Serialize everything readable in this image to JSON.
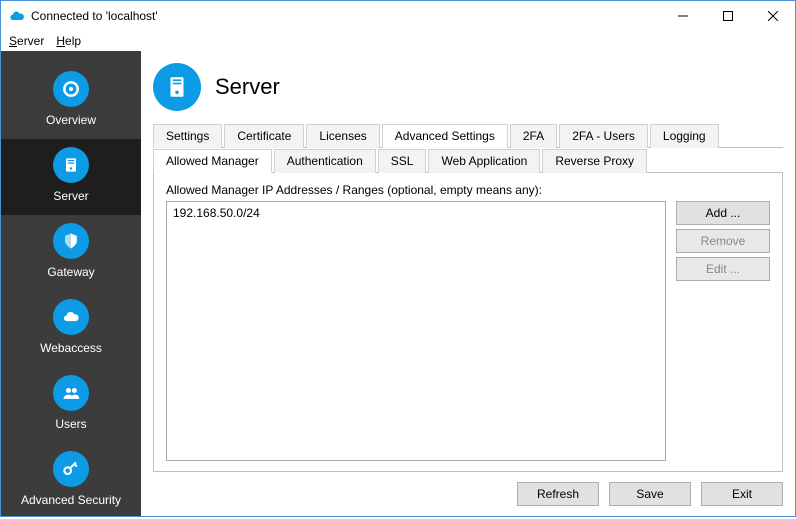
{
  "window": {
    "title": "Connected to 'localhost'"
  },
  "menu": {
    "server": "Server",
    "help": "Help"
  },
  "sidebar": {
    "items": [
      {
        "label": "Overview"
      },
      {
        "label": "Server"
      },
      {
        "label": "Gateway"
      },
      {
        "label": "Webaccess"
      },
      {
        "label": "Users"
      },
      {
        "label": "Advanced Security"
      }
    ]
  },
  "header": {
    "title": "Server"
  },
  "tabs_outer": {
    "items": [
      {
        "label": "Settings"
      },
      {
        "label": "Certificate"
      },
      {
        "label": "Licenses"
      },
      {
        "label": "Advanced Settings"
      },
      {
        "label": "2FA"
      },
      {
        "label": "2FA - Users"
      },
      {
        "label": "Logging"
      }
    ],
    "active_index": 3
  },
  "tabs_inner": {
    "items": [
      {
        "label": "Allowed Manager"
      },
      {
        "label": "Authentication"
      },
      {
        "label": "SSL"
      },
      {
        "label": "Web Application"
      },
      {
        "label": "Reverse Proxy"
      }
    ],
    "active_index": 0
  },
  "panel": {
    "field_label": "Allowed Manager IP Addresses / Ranges (optional, empty means any):",
    "items": [
      "192.168.50.0/24"
    ],
    "buttons": {
      "add": "Add ...",
      "remove": "Remove",
      "edit": "Edit ..."
    }
  },
  "footer": {
    "refresh": "Refresh",
    "save": "Save",
    "exit": "Exit"
  }
}
